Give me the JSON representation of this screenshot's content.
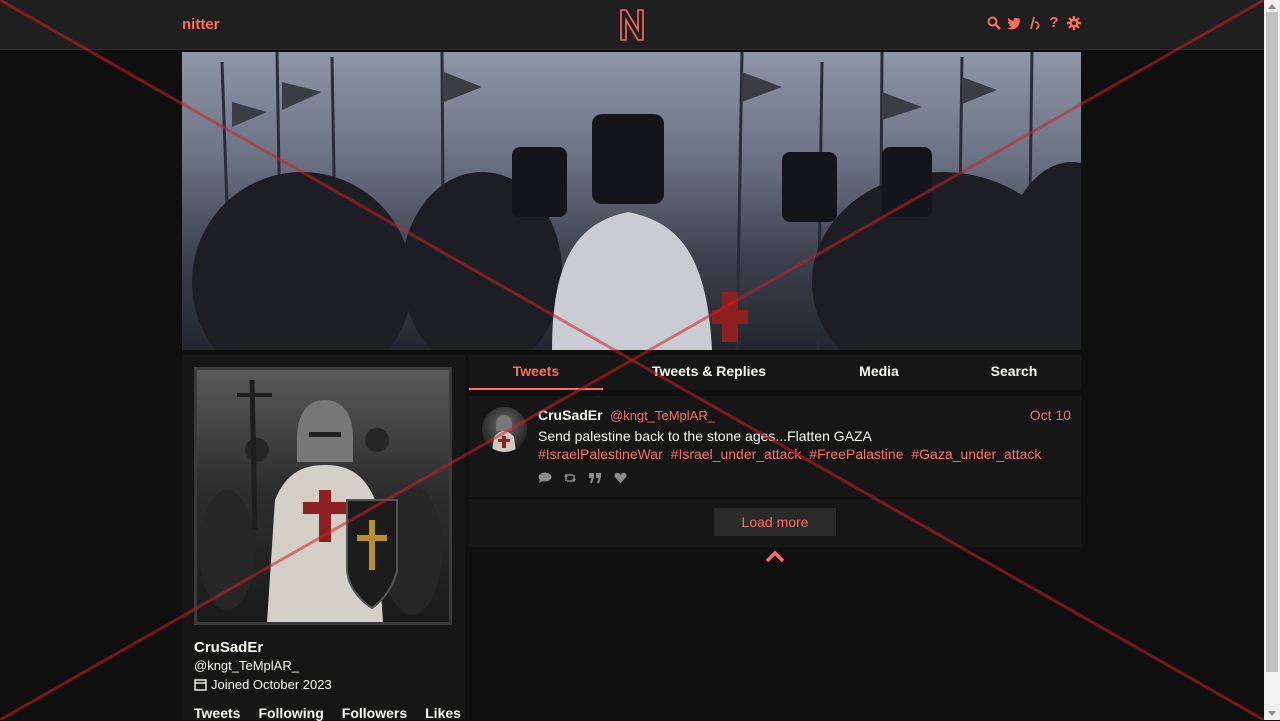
{
  "nav": {
    "brand": "nitter",
    "logo_letter": "N",
    "icons": [
      "search-icon",
      "twitter-icon",
      "rss-icon",
      "help-icon",
      "settings-icon"
    ],
    "help_glyph": "?"
  },
  "colors": {
    "accent": "#ff6c60",
    "background": "#0f0f0f",
    "panel": "#161616",
    "nav": "#1f1f1f",
    "text": "#f8f8f2",
    "muted": "#8a8a8a",
    "overlay_x": "#cc2020"
  },
  "profile": {
    "fullname": "CruSadEr",
    "username": "@kngt_TeMplAR_",
    "joined": "Joined October 2023",
    "stats": [
      "Tweets",
      "Following",
      "Followers",
      "Likes"
    ]
  },
  "tabs": [
    {
      "label": "Tweets",
      "active": true
    },
    {
      "label": "Tweets & Replies",
      "active": false
    },
    {
      "label": "Media",
      "active": false
    },
    {
      "label": "Search",
      "active": false
    }
  ],
  "tweet": {
    "fullname": "CruSadEr",
    "username": "@kngt_TeMplAR_",
    "date": "Oct 10",
    "text": "Send palestine back to the stone ages...Flatten GAZA",
    "hashtags": [
      "#IsraelPalestineWar",
      "#Israel_under_attack",
      "#FreePalastine",
      "#Gaza_under_attack"
    ],
    "actions": [
      "reply-icon",
      "retweet-icon",
      "quote-icon",
      "like-icon"
    ]
  },
  "timeline": {
    "load_more": "Load more"
  }
}
